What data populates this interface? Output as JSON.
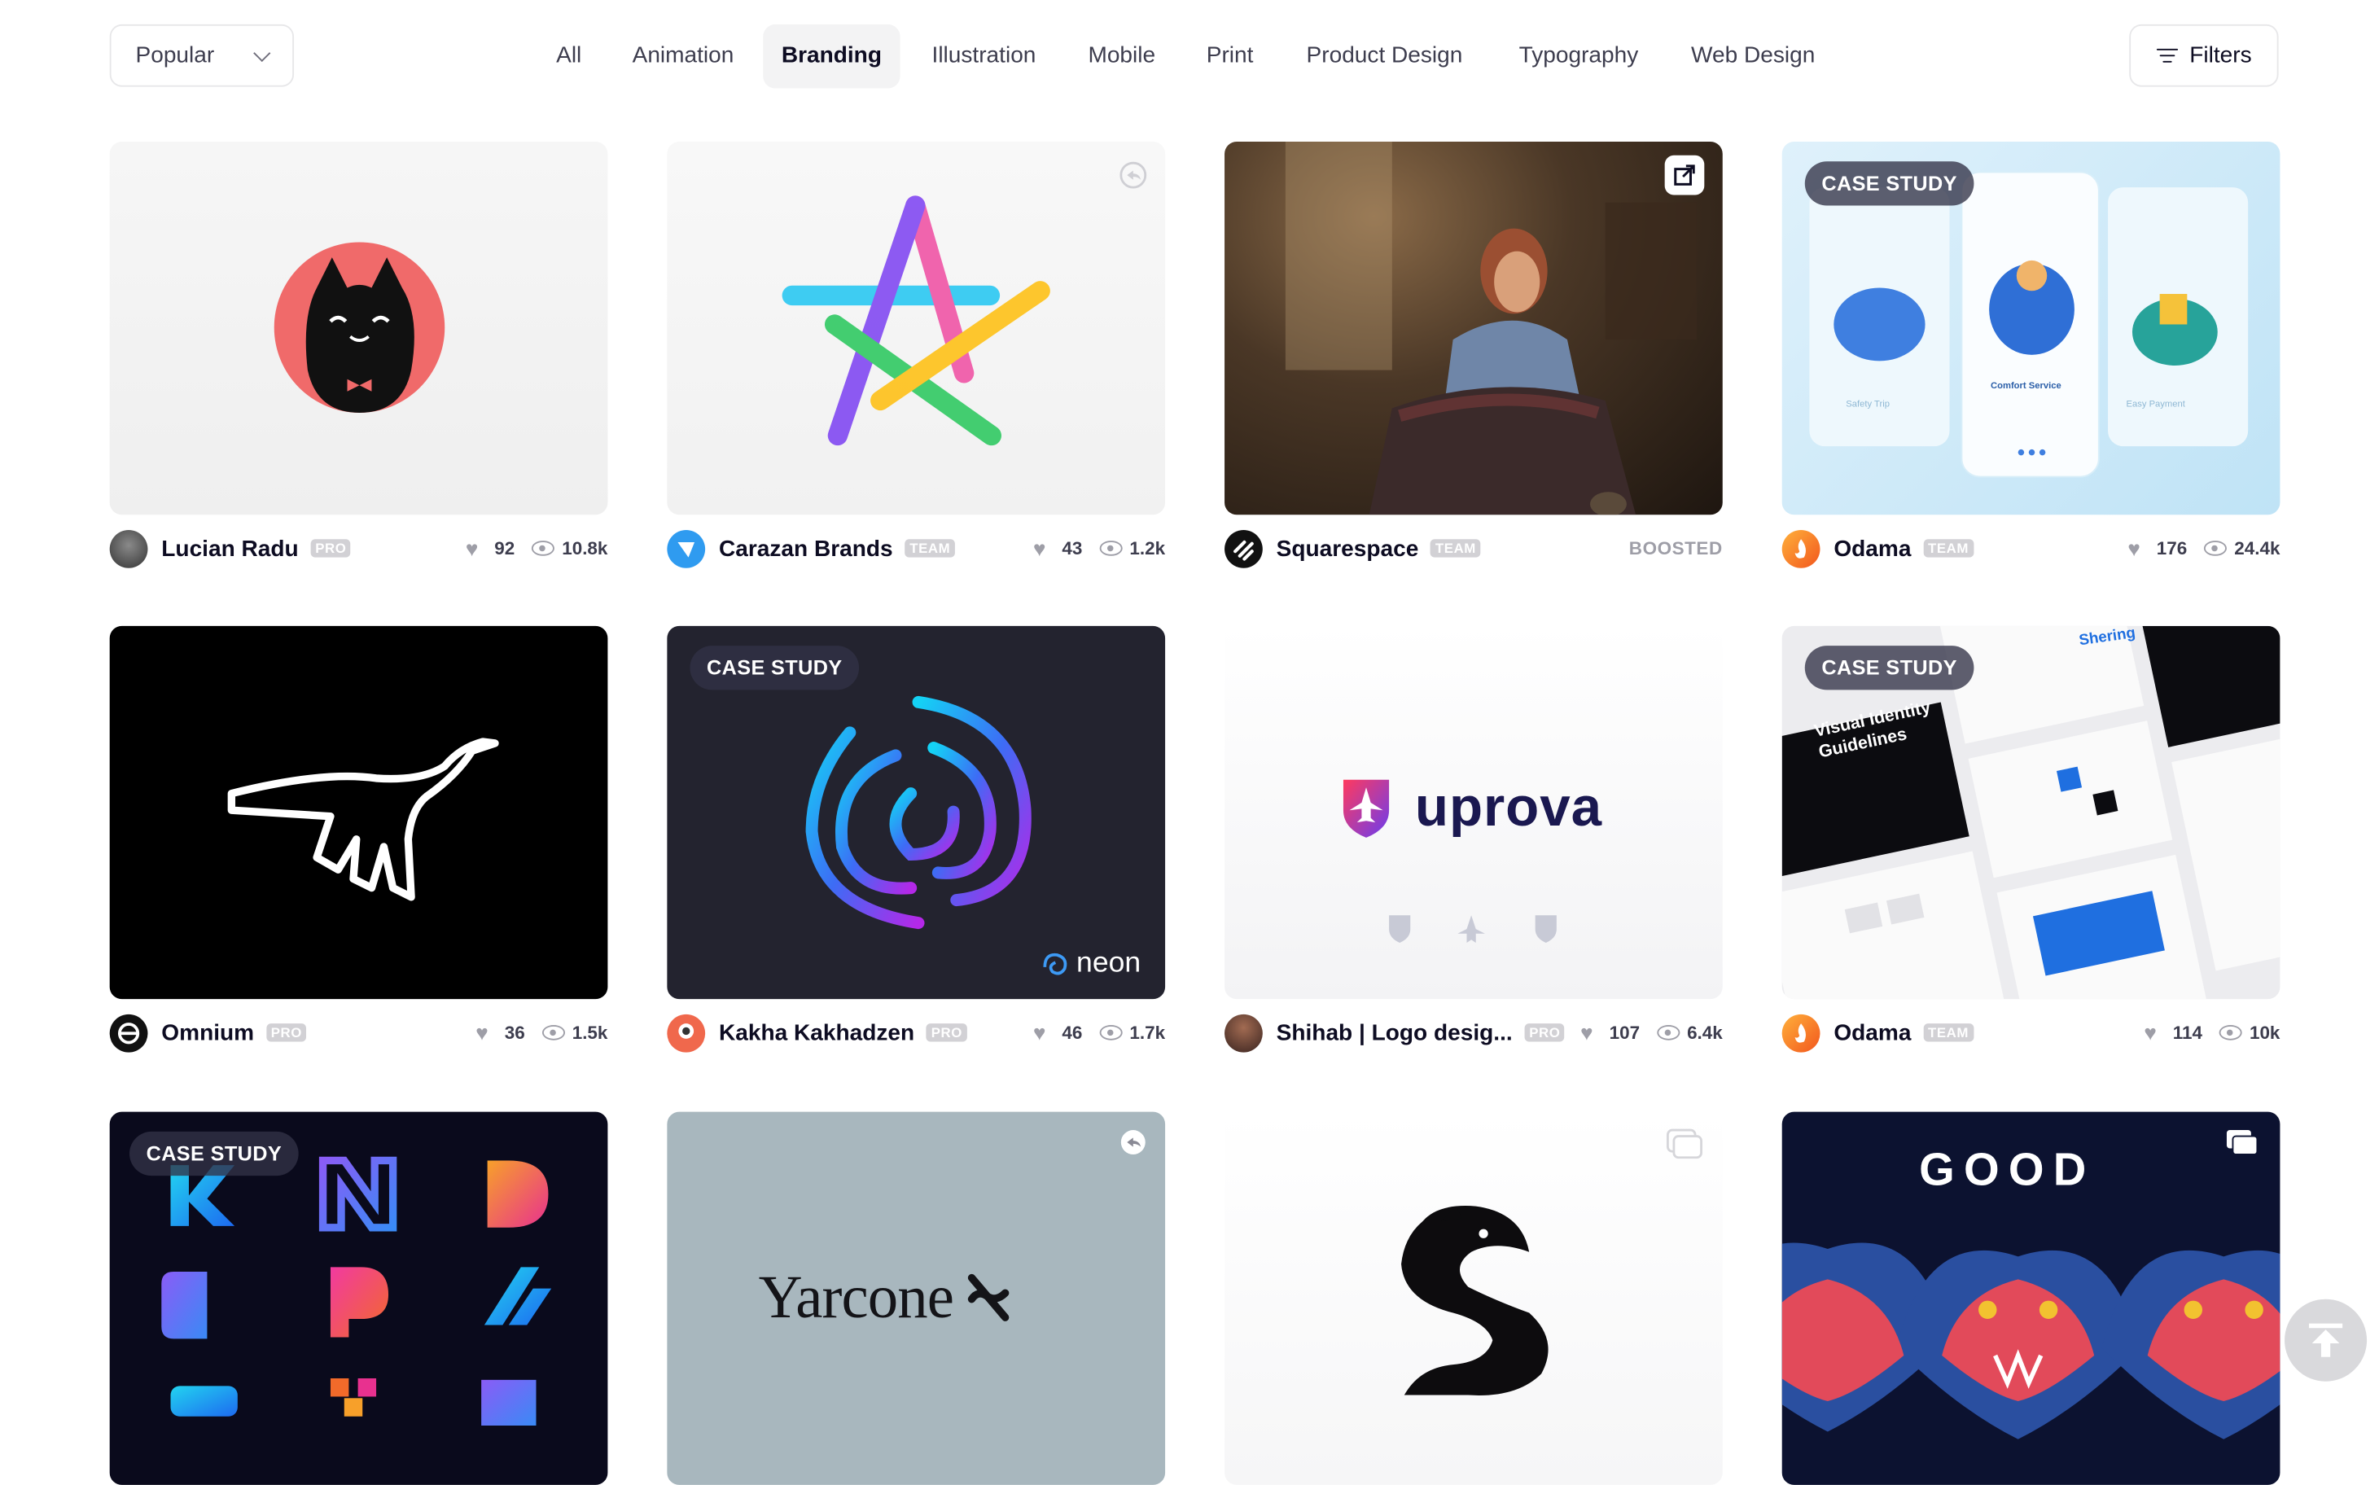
{
  "sort": {
    "selected": "Popular"
  },
  "tabs": [
    {
      "label": "All"
    },
    {
      "label": "Animation"
    },
    {
      "label": "Branding"
    },
    {
      "label": "Illustration"
    },
    {
      "label": "Mobile"
    },
    {
      "label": "Print"
    },
    {
      "label": "Product Design"
    },
    {
      "label": "Typography"
    },
    {
      "label": "Web Design"
    }
  ],
  "active_tab": "Branding",
  "filters": {
    "label": "Filters"
  },
  "shots": [
    {
      "author": "Lucian Radu",
      "badge": "PRO",
      "likes": "92",
      "views": "10.8k"
    },
    {
      "author": "Carazan Brands",
      "badge": "TEAM",
      "likes": "43",
      "views": "1.2k"
    },
    {
      "author": "Squarespace",
      "badge": "TEAM",
      "boosted": "BOOSTED"
    },
    {
      "author": "Odama",
      "badge": "TEAM",
      "likes": "176",
      "views": "24.4k",
      "tag": "CASE STUDY",
      "screens": [
        "Safety Trip",
        "Comfort Service",
        "Easy Payment"
      ]
    },
    {
      "author": "Omnium",
      "badge": "PRO",
      "likes": "36",
      "views": "1.5k"
    },
    {
      "author": "Kakha Kakhadzen",
      "badge": "PRO",
      "likes": "46",
      "views": "1.7k",
      "tag": "CASE STUDY",
      "logo_text": "neon"
    },
    {
      "author": "Shihab | Logo desig...",
      "badge": "PRO",
      "likes": "107",
      "views": "6.4k",
      "logo_text": "uprova"
    },
    {
      "author": "Odama",
      "badge": "TEAM",
      "likes": "114",
      "views": "10k",
      "tag": "CASE STUDY",
      "headline": "Visual Identity Guidelines",
      "brand": "Shering"
    },
    {
      "tag": "CASE STUDY"
    },
    {
      "logo_text": "Yarcone"
    },
    {},
    {
      "pattern_text": "GOOD"
    }
  ],
  "colors": {
    "accent": "#ea4c89",
    "tab_active_bg": "#f3f3f4",
    "badge_bg": "#d2d1d5"
  }
}
